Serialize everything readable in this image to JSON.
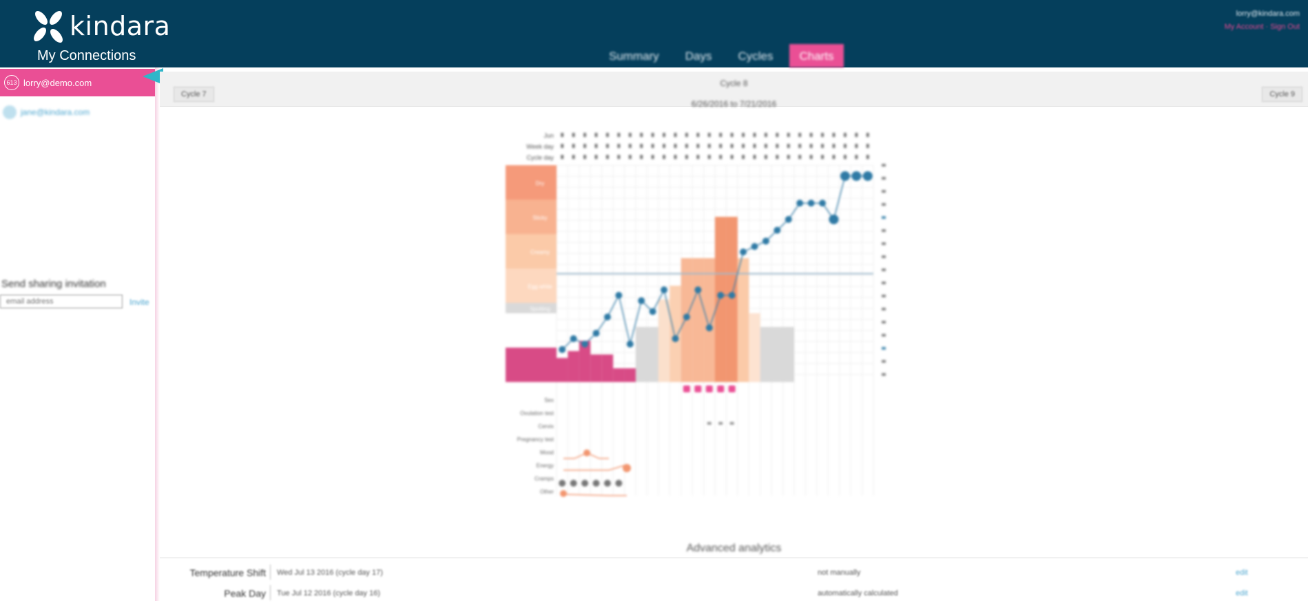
{
  "app": {
    "brand": "kindara",
    "user_email": "lorry@kindara.com",
    "user_links": "My Account · Sign Out"
  },
  "nav": {
    "tabs": [
      {
        "label": "Summary",
        "active": false
      },
      {
        "label": "Days",
        "active": false
      },
      {
        "label": "Cycles",
        "active": false
      },
      {
        "label": "Charts",
        "active": true
      }
    ]
  },
  "sidebar": {
    "title": "My Connections",
    "connections": [
      {
        "badge": "613",
        "email": "lorry@demo.com",
        "active": true
      },
      {
        "email": "jane@kindara.com",
        "active": false
      }
    ],
    "invite": {
      "title": "Send sharing invitation",
      "placeholder": "email address",
      "button": "Invite"
    }
  },
  "cycle": {
    "title": "Cycle 8",
    "range": "6/26/2016 to 7/21/2016",
    "prev_label": "Cycle 7",
    "next_label": "Cycle 9"
  },
  "chart": {
    "header_rows": [
      "Jun",
      "Week day",
      "Cycle day"
    ],
    "zones": [
      "Dry",
      "Sticky",
      "Creamy",
      "Egg white",
      "Spotting"
    ],
    "fluid_labels": [
      "Creamy",
      "Eggwhite",
      "Spotting"
    ],
    "side_labels": [
      "Sex",
      "Ovulation test",
      "Cervix",
      "Pregnancy test",
      "Mood",
      "Energy",
      "Cramps",
      "Other"
    ],
    "temperature_series": [
      97.3,
      97.4,
      97.35,
      97.45,
      97.6,
      97.8,
      97.35,
      97.75,
      97.65,
      97.85,
      97.4,
      97.6,
      97.85,
      97.5,
      97.8,
      97.8,
      98.2,
      98.25,
      98.3,
      98.4,
      98.5,
      98.65,
      98.65,
      98.65,
      98.5,
      98.9,
      98.9,
      98.9
    ],
    "coverline": 98.0
  },
  "analytics": {
    "title": "Advanced analytics",
    "rows": [
      {
        "label": "Temperature Shift",
        "value": "Wed Jul 13 2016 (cycle day 17)",
        "detail": "not manually",
        "edit": "edit"
      },
      {
        "label": "Peak Day",
        "value": "Tue Jul 12 2016 (cycle day 16)",
        "detail": "automatically calculated",
        "edit": "edit"
      }
    ]
  },
  "colors": {
    "header_bg": "#053f5c",
    "accent_pink": "#ea4f95",
    "link_blue": "#4da6cf",
    "arrow_teal": "#2fb6c9"
  }
}
